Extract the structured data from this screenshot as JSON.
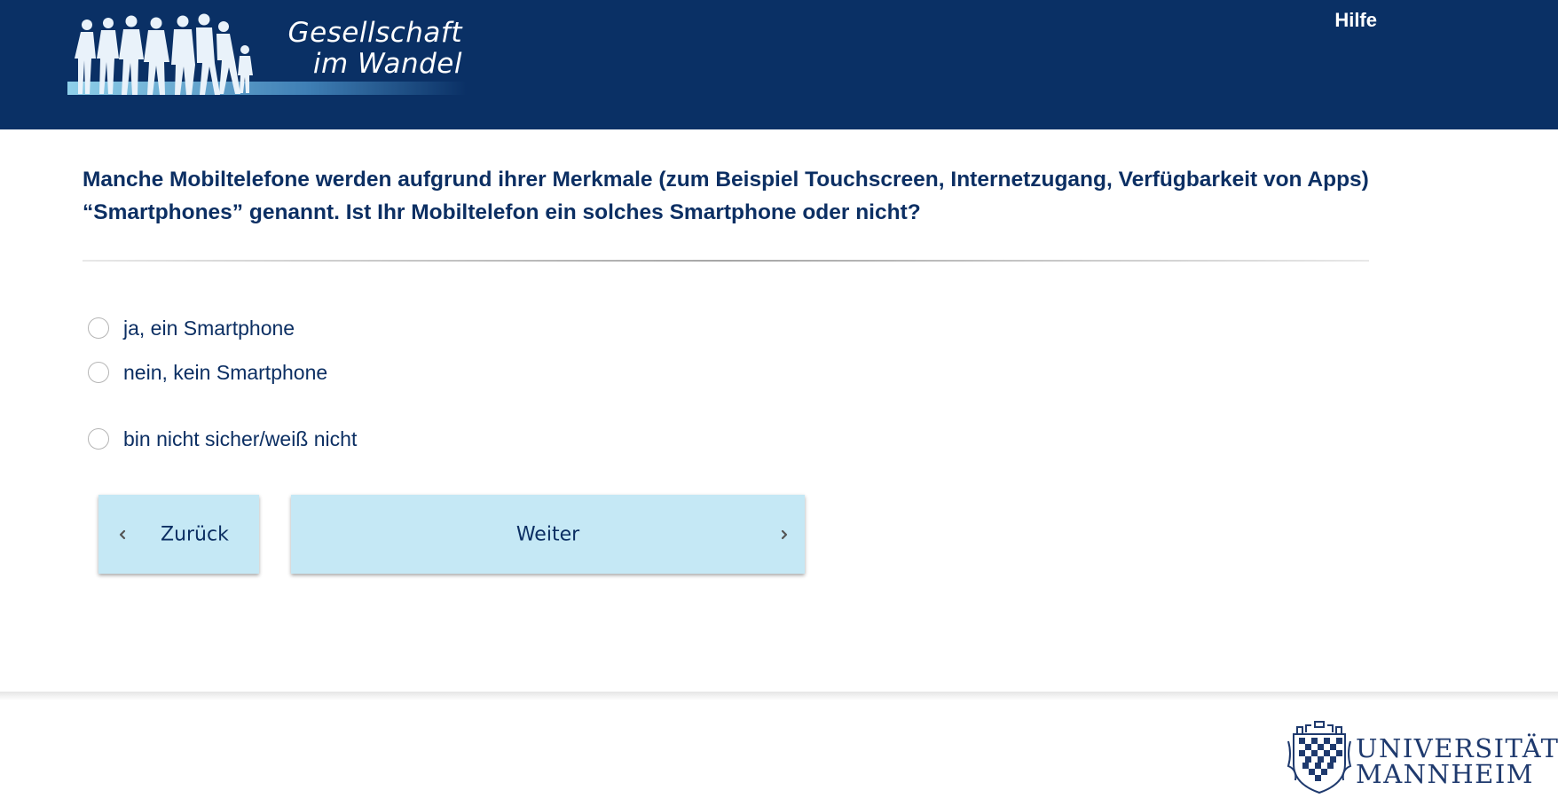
{
  "header": {
    "logo": {
      "line1": "Gesellschaft",
      "line2": "im Wandel"
    },
    "help_label": "Hilfe"
  },
  "question": {
    "text": "Manche Mobiltelefone werden aufgrund ihrer Merkmale (zum Beispiel Touchscreen, Internetzugang, Verfügbarkeit von Apps) “Smartphones” genannt. Ist Ihr Mobiltelefon ein solches Smartphone oder nicht?"
  },
  "options": [
    {
      "label": "ja, ein Smartphone",
      "selected": false
    },
    {
      "label": "nein, kein Smartphone",
      "selected": false
    },
    {
      "label": "bin nicht sicher/weiß nicht",
      "selected": false
    }
  ],
  "navigation": {
    "back_label": "Zurück",
    "next_label": "Weiter"
  },
  "footer": {
    "university_line1": "UNIVERSITÄT",
    "university_line2": "MANNHEIM"
  },
  "colors": {
    "header_bg": "#0a3065",
    "text_primary": "#0c2f63",
    "button_bg": "#c5e8f5"
  }
}
